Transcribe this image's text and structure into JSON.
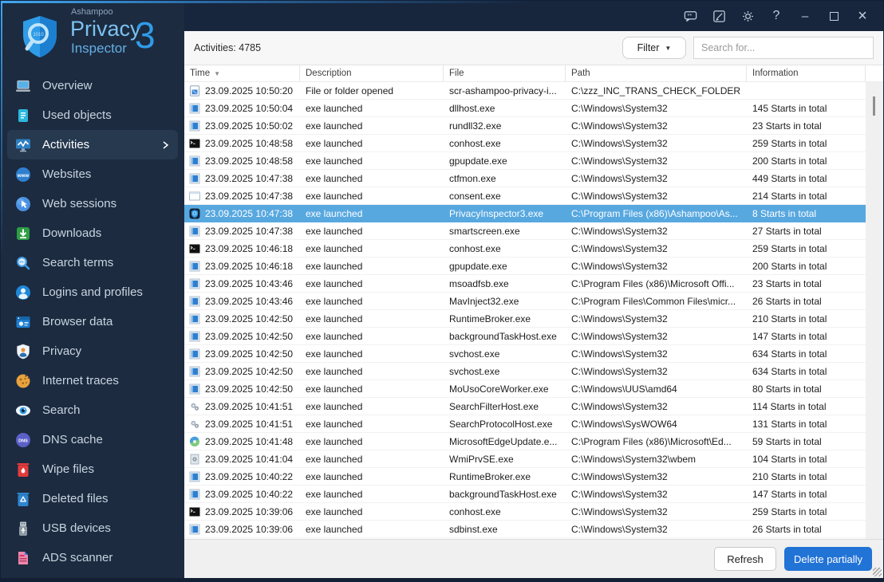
{
  "app": {
    "brand_small": "Ashampoo",
    "brand_line1": "Privacy",
    "brand_line2": "Inspector",
    "brand_version": "3"
  },
  "colors": {
    "accent": "#2f9ce8",
    "selection_blue": "#58a8e0",
    "sidebar_bg": "#1c2b40",
    "titlebar_bg": "#17263d",
    "delete_button_blue": "#2173d6"
  },
  "titlebar": {
    "icons": [
      {
        "name": "feedback-icon",
        "type": "svg"
      },
      {
        "name": "notes-icon",
        "type": "svg"
      },
      {
        "name": "settings-icon",
        "type": "svg"
      },
      {
        "name": "help-icon",
        "type": "glyph",
        "glyph": "?"
      },
      {
        "name": "minimize-icon",
        "type": "glyph",
        "glyph": "–"
      },
      {
        "name": "maximize-icon",
        "type": "box"
      },
      {
        "name": "close-icon",
        "type": "glyph",
        "glyph": "×"
      }
    ]
  },
  "sidebar": {
    "items": [
      {
        "label": "Overview",
        "icon": "laptop-icon",
        "selected": false
      },
      {
        "label": "Used objects",
        "icon": "document-icon",
        "selected": false
      },
      {
        "label": "Activities",
        "icon": "activity-chart-icon",
        "selected": true,
        "chevron": true
      },
      {
        "label": "Websites",
        "icon": "globe-www-icon",
        "selected": false
      },
      {
        "label": "Web sessions",
        "icon": "cursor-globe-icon",
        "selected": false
      },
      {
        "label": "Downloads",
        "icon": "download-icon",
        "selected": false
      },
      {
        "label": "Search terms",
        "icon": "magnifier-icon",
        "selected": false
      },
      {
        "label": "Logins and profiles",
        "icon": "user-icon",
        "selected": false
      },
      {
        "label": "Browser data",
        "icon": "browser-window-icon",
        "selected": false
      },
      {
        "label": "Privacy",
        "icon": "shield-person-icon",
        "selected": false
      },
      {
        "label": "Internet traces",
        "icon": "cookie-icon",
        "selected": false
      },
      {
        "label": "Search",
        "icon": "eye-icon",
        "selected": false
      },
      {
        "label": "DNS cache",
        "icon": "dns-badge-icon",
        "selected": false
      },
      {
        "label": "Wipe files",
        "icon": "wipe-trash-icon",
        "selected": false
      },
      {
        "label": "Deleted files",
        "icon": "recycle-bin-icon",
        "selected": false
      },
      {
        "label": "USB devices",
        "icon": "usb-stick-icon",
        "selected": false
      },
      {
        "label": "ADS scanner",
        "icon": "ads-file-icon",
        "selected": false
      }
    ]
  },
  "toolbar": {
    "activities_count_label": "Activities: 4785",
    "filter_label": "Filter",
    "search_placeholder": "Search for..."
  },
  "table": {
    "columns": [
      "Time",
      "Description",
      "File",
      "Path",
      "Information"
    ],
    "sorted_column": "Time",
    "sort_direction": "desc",
    "rows": [
      {
        "icon": "file-opened-icon",
        "time": "23.09.2025 10:50:20",
        "description": "File or folder opened",
        "file": "scr-ashampoo-privacy-i...",
        "path": "C:\\zzz_INC_TRANS_CHECK_FOLDER",
        "information": "",
        "selected": false
      },
      {
        "icon": "exe-window-icon",
        "time": "23.09.2025 10:50:04",
        "description": "exe launched",
        "file": "dllhost.exe",
        "path": "C:\\Windows\\System32",
        "information": "145 Starts in total",
        "selected": false
      },
      {
        "icon": "exe-window-icon",
        "time": "23.09.2025 10:50:02",
        "description": "exe launched",
        "file": "rundll32.exe",
        "path": "C:\\Windows\\System32",
        "information": "23 Starts in total",
        "selected": false
      },
      {
        "icon": "console-icon",
        "time": "23.09.2025 10:48:58",
        "description": "exe launched",
        "file": "conhost.exe",
        "path": "C:\\Windows\\System32",
        "information": "259 Starts in total",
        "selected": false
      },
      {
        "icon": "exe-window-icon",
        "time": "23.09.2025 10:48:58",
        "description": "exe launched",
        "file": "gpupdate.exe",
        "path": "C:\\Windows\\System32",
        "information": "200 Starts in total",
        "selected": false
      },
      {
        "icon": "exe-window-icon",
        "time": "23.09.2025 10:47:38",
        "description": "exe launched",
        "file": "ctfmon.exe",
        "path": "C:\\Windows\\System32",
        "information": "449 Starts in total",
        "selected": false
      },
      {
        "icon": "dialog-window-icon",
        "time": "23.09.2025 10:47:38",
        "description": "exe launched",
        "file": "consent.exe",
        "path": "C:\\Windows\\System32",
        "information": "214 Starts in total",
        "selected": false
      },
      {
        "icon": "privacy-inspector-icon",
        "time": "23.09.2025 10:47:38",
        "description": "exe launched",
        "file": "PrivacyInspector3.exe",
        "path": "C:\\Program Files (x86)\\Ashampoo\\As...",
        "information": "8 Starts in total",
        "selected": true
      },
      {
        "icon": "exe-window-icon",
        "time": "23.09.2025 10:47:38",
        "description": "exe launched",
        "file": "smartscreen.exe",
        "path": "C:\\Windows\\System32",
        "information": "27 Starts in total",
        "selected": false
      },
      {
        "icon": "console-icon",
        "time": "23.09.2025 10:46:18",
        "description": "exe launched",
        "file": "conhost.exe",
        "path": "C:\\Windows\\System32",
        "information": "259 Starts in total",
        "selected": false
      },
      {
        "icon": "exe-window-icon",
        "time": "23.09.2025 10:46:18",
        "description": "exe launched",
        "file": "gpupdate.exe",
        "path": "C:\\Windows\\System32",
        "information": "200 Starts in total",
        "selected": false
      },
      {
        "icon": "exe-window-icon",
        "time": "23.09.2025 10:43:46",
        "description": "exe launched",
        "file": "msoadfsb.exe",
        "path": "C:\\Program Files (x86)\\Microsoft Offi...",
        "information": "23 Starts in total",
        "selected": false
      },
      {
        "icon": "exe-window-icon",
        "time": "23.09.2025 10:43:46",
        "description": "exe launched",
        "file": "MavInject32.exe",
        "path": "C:\\Program Files\\Common Files\\micr...",
        "information": "26 Starts in total",
        "selected": false
      },
      {
        "icon": "exe-window-icon",
        "time": "23.09.2025 10:42:50",
        "description": "exe launched",
        "file": "RuntimeBroker.exe",
        "path": "C:\\Windows\\System32",
        "information": "210 Starts in total",
        "selected": false
      },
      {
        "icon": "exe-window-icon",
        "time": "23.09.2025 10:42:50",
        "description": "exe launched",
        "file": "backgroundTaskHost.exe",
        "path": "C:\\Windows\\System32",
        "information": "147 Starts in total",
        "selected": false
      },
      {
        "icon": "exe-window-icon",
        "time": "23.09.2025 10:42:50",
        "description": "exe launched",
        "file": "svchost.exe",
        "path": "C:\\Windows\\System32",
        "information": "634 Starts in total",
        "selected": false
      },
      {
        "icon": "exe-window-icon",
        "time": "23.09.2025 10:42:50",
        "description": "exe launched",
        "file": "svchost.exe",
        "path": "C:\\Windows\\System32",
        "information": "634 Starts in total",
        "selected": false
      },
      {
        "icon": "exe-window-icon",
        "time": "23.09.2025 10:42:50",
        "description": "exe launched",
        "file": "MoUsoCoreWorker.exe",
        "path": "C:\\Windows\\UUS\\amd64",
        "information": "80 Starts in total",
        "selected": false
      },
      {
        "icon": "gears-icon",
        "time": "23.09.2025 10:41:51",
        "description": "exe launched",
        "file": "SearchFilterHost.exe",
        "path": "C:\\Windows\\System32",
        "information": "114 Starts in total",
        "selected": false
      },
      {
        "icon": "gears-icon",
        "time": "23.09.2025 10:41:51",
        "description": "exe launched",
        "file": "SearchProtocolHost.exe",
        "path": "C:\\Windows\\SysWOW64",
        "information": "131 Starts in total",
        "selected": false
      },
      {
        "icon": "edge-update-icon",
        "time": "23.09.2025 10:41:48",
        "description": "exe launched",
        "file": "MicrosoftEdgeUpdate.e...",
        "path": "C:\\Program Files (x86)\\Microsoft\\Ed...",
        "information": "59 Starts in total",
        "selected": false
      },
      {
        "icon": "wmi-gear-icon",
        "time": "23.09.2025 10:41:04",
        "description": "exe launched",
        "file": "WmiPrvSE.exe",
        "path": "C:\\Windows\\System32\\wbem",
        "information": "104 Starts in total",
        "selected": false
      },
      {
        "icon": "exe-window-icon",
        "time": "23.09.2025 10:40:22",
        "description": "exe launched",
        "file": "RuntimeBroker.exe",
        "path": "C:\\Windows\\System32",
        "information": "210 Starts in total",
        "selected": false
      },
      {
        "icon": "exe-window-icon",
        "time": "23.09.2025 10:40:22",
        "description": "exe launched",
        "file": "backgroundTaskHost.exe",
        "path": "C:\\Windows\\System32",
        "information": "147 Starts in total",
        "selected": false
      },
      {
        "icon": "console-icon",
        "time": "23.09.2025 10:39:06",
        "description": "exe launched",
        "file": "conhost.exe",
        "path": "C:\\Windows\\System32",
        "information": "259 Starts in total",
        "selected": false
      },
      {
        "icon": "exe-window-icon",
        "time": "23.09.2025 10:39:06",
        "description": "exe launched",
        "file": "sdbinst.exe",
        "path": "C:\\Windows\\System32",
        "information": "26 Starts in total",
        "selected": false
      }
    ]
  },
  "footer": {
    "refresh_label": "Refresh",
    "delete_label": "Delete partially"
  }
}
